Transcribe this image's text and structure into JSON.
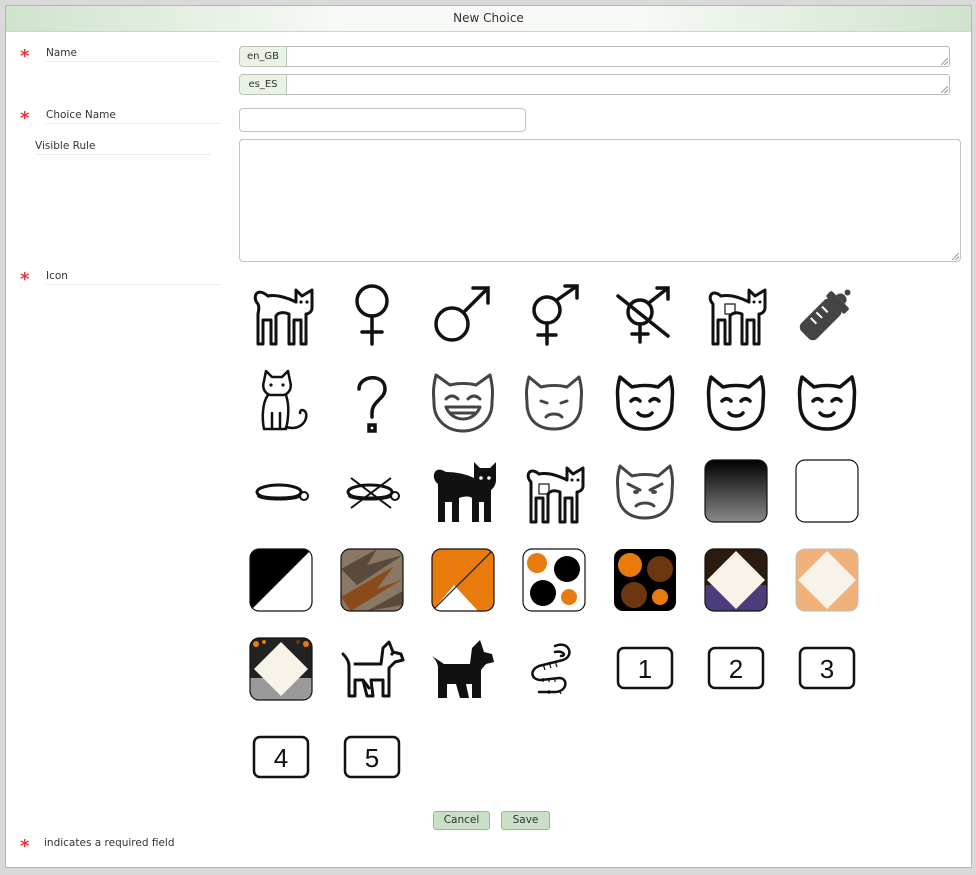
{
  "dialog": {
    "title": "New Choice"
  },
  "form": {
    "required_marker": "*",
    "name_label": "Name",
    "name_langs": [
      "en_GB",
      "es_ES"
    ],
    "choice_name_label": "Choice Name",
    "choice_name_value": "",
    "visible_rule_label": "Visible Rule",
    "visible_rule_value": "",
    "icon_label": "Icon"
  },
  "icons": [
    "cat-standing-icon",
    "female-symbol-icon",
    "male-symbol-icon",
    "intersex-symbol-icon",
    "neutered-symbol-icon",
    "cat-tagged-icon",
    "baby-bottle-icon",
    "kitten-sitting-icon",
    "question-mark-icon",
    "cat-face-grinning-icon",
    "cat-face-sad-icon",
    "cat-face-content-icon",
    "cat-face-content-icon",
    "cat-face-content-icon",
    "collar-icon",
    "collar-crossed-icon",
    "cat-black-icon",
    "cat-tagged-outline-icon",
    "cat-face-angry-icon",
    "gradient-swatch-icon",
    "white-swatch-icon",
    "black-white-swatch-icon",
    "tabby-swatch-icon",
    "orange-white-swatch-icon",
    "calico-white-swatch-icon",
    "tortie-swatch-icon",
    "cream-purple-swatch-icon",
    "cream-peach-swatch-icon",
    "spotted-cream-swatch-icon",
    "dog-outline-icon",
    "dog-black-icon",
    "worm-icon",
    "number-1-icon",
    "number-2-icon",
    "number-3-icon",
    "number-4-icon",
    "number-5-icon"
  ],
  "numbers": [
    "1",
    "2",
    "3",
    "4",
    "5"
  ],
  "buttons": {
    "cancel": "Cancel",
    "save": "Save"
  },
  "footer": {
    "required_note": "indicates a required field"
  }
}
